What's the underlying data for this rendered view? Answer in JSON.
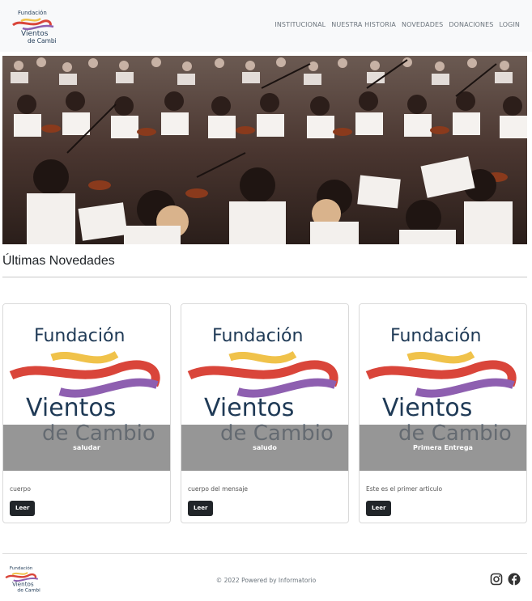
{
  "brand": {
    "logo_lines": [
      "Fundación",
      "Vientos",
      "de Cambio"
    ],
    "colors": {
      "navy": "#1f3a56",
      "red": "#d9453a",
      "yellow": "#f0c24a",
      "purple": "#8e5fb0"
    }
  },
  "nav": {
    "items": [
      {
        "label": "INSTITUCIONAL"
      },
      {
        "label": "NUESTRA HISTORIA"
      },
      {
        "label": "NOVEDADES"
      },
      {
        "label": "DONACIONES"
      },
      {
        "label": "LOGIN"
      }
    ]
  },
  "hero": {
    "image": "orchestra-students-playing-violins"
  },
  "section": {
    "title": "Últimas Novedades"
  },
  "cards": [
    {
      "caption": "saludar",
      "text": "cuerpo",
      "button": "Leer"
    },
    {
      "caption": "saludo",
      "text": "cuerpo del mensaje",
      "button": "Leer"
    },
    {
      "caption": "Primera Entrega",
      "text": "Este es el primer articulo",
      "button": "Leer"
    }
  ],
  "footer": {
    "copyright": "© 2022 Powered by Informatorio",
    "social": [
      {
        "icon": "instagram-icon"
      },
      {
        "icon": "facebook-icon"
      }
    ]
  }
}
